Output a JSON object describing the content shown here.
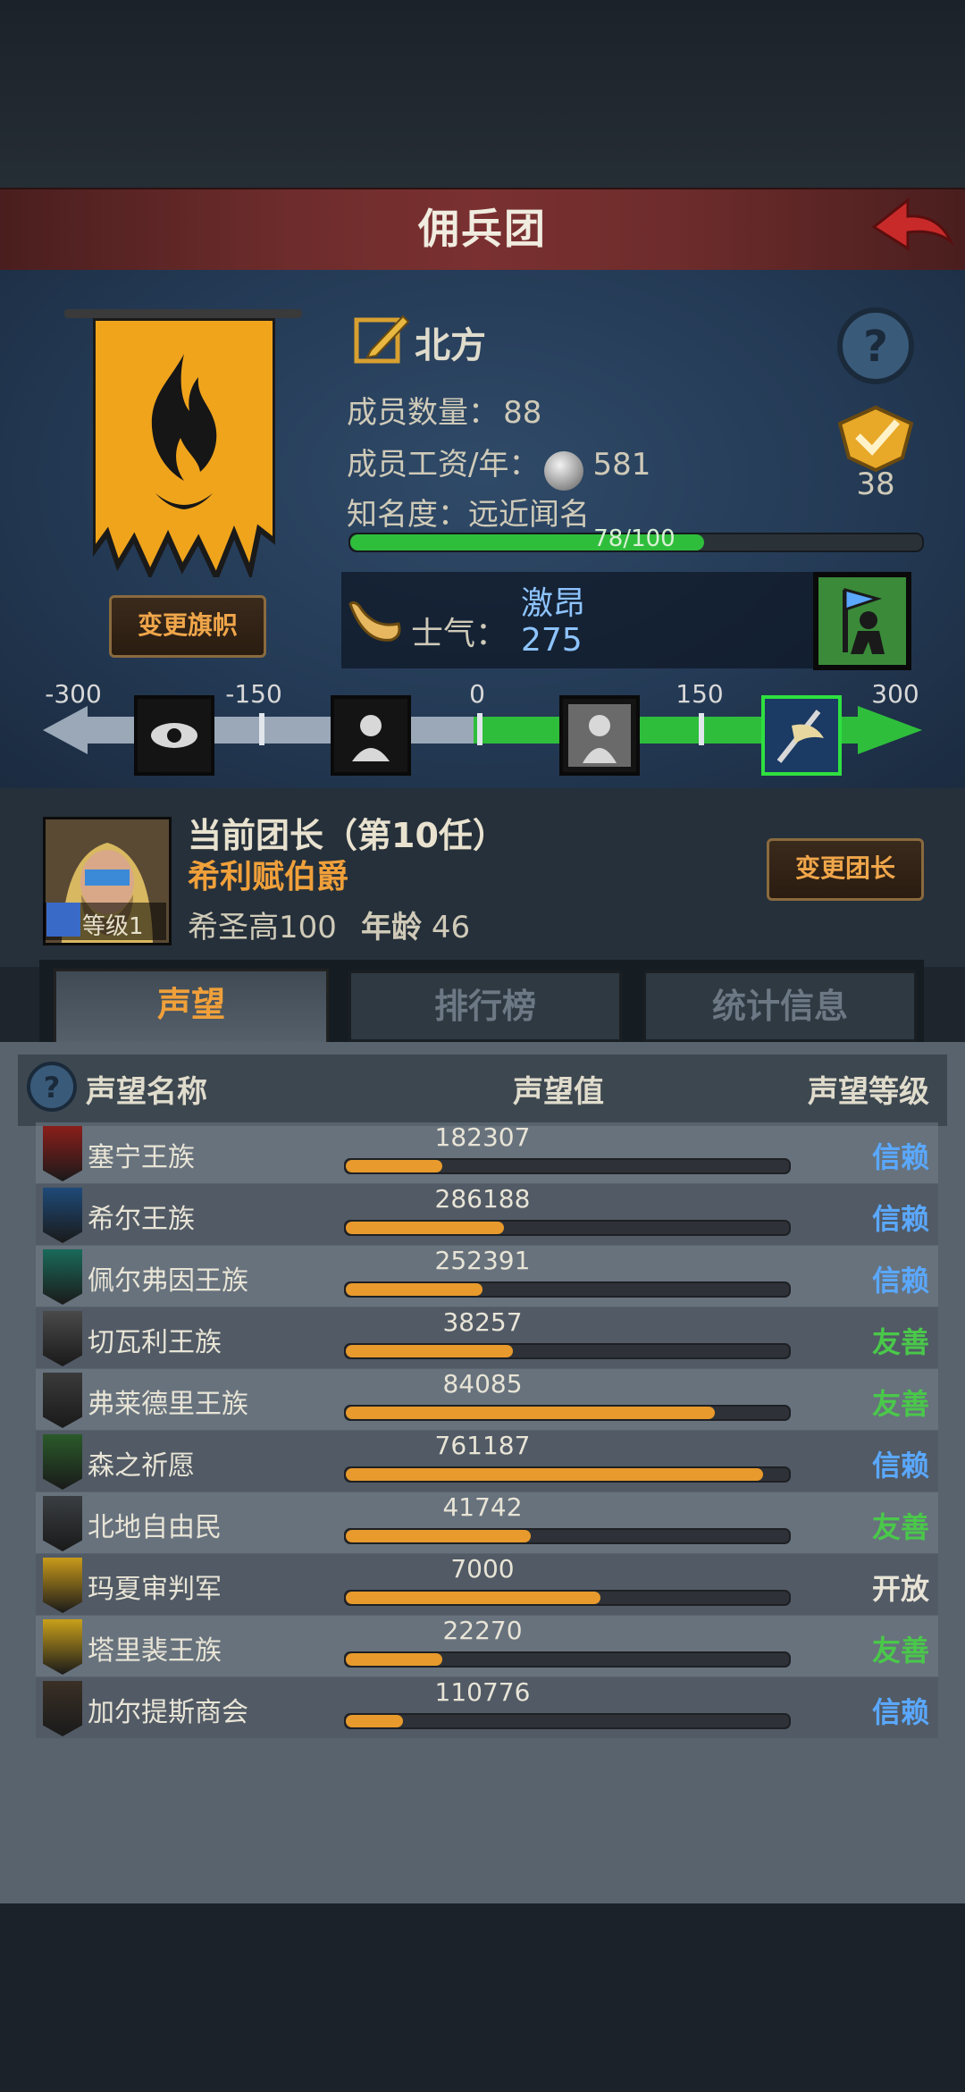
{
  "title": "佣兵团",
  "company": {
    "name": "北方",
    "members_label": "成员数量：",
    "members_value": "88",
    "salary_label": "成员工资/年：",
    "salary_value": "581",
    "fame_label": "知名度：",
    "fame_value": "远近闻名",
    "fame_progress_text": "78/100",
    "fame_progress_fraction": 0.78,
    "quest_count": "38",
    "change_banner_label": "变更旗帜"
  },
  "morale": {
    "label": "士气：",
    "state": "激昂",
    "value": "275",
    "scale_ticks": [
      "-300",
      "-150",
      "0",
      "150",
      "300"
    ],
    "scale_min": -300,
    "scale_max": 300,
    "current": 275
  },
  "leader": {
    "title": "当前团长（第10任）",
    "name": "希利赋伯爵",
    "level": "等级1",
    "skill": "希圣高100",
    "age_label": "年龄",
    "age": "46",
    "change_leader_label": "变更团长"
  },
  "tabs": [
    {
      "label": "声望",
      "active": true
    },
    {
      "label": "排行榜",
      "active": false
    },
    {
      "label": "统计信息",
      "active": false
    }
  ],
  "reputation": {
    "columns": [
      "声望名称",
      "声望值",
      "声望等级"
    ],
    "rows": [
      {
        "name": "塞宁王族",
        "value": "182307",
        "level": "信赖",
        "fill": 0.22,
        "icon_color": "#8a1e1a"
      },
      {
        "name": "希尔王族",
        "value": "286188",
        "level": "信赖",
        "fill": 0.36,
        "icon_color": "#1e4a78"
      },
      {
        "name": "佩尔弗因王族",
        "value": "252391",
        "level": "信赖",
        "fill": 0.31,
        "icon_color": "#1a6a5a"
      },
      {
        "name": "切瓦利王族",
        "value": "38257",
        "level": "友善",
        "fill": 0.38,
        "icon_color": "#4a4a4a"
      },
      {
        "name": "弗莱德里王族",
        "value": "84085",
        "level": "友善",
        "fill": 0.84,
        "icon_color": "#3a3a3a"
      },
      {
        "name": "森之祈愿",
        "value": "761187",
        "level": "信赖",
        "fill": 0.95,
        "icon_color": "#2a5a2a"
      },
      {
        "name": "北地自由民",
        "value": "41742",
        "level": "友善",
        "fill": 0.42,
        "icon_color": "#3a3e42"
      },
      {
        "name": "玛夏审判军",
        "value": "7000",
        "level": "开放",
        "fill": 0.58,
        "icon_color": "#c89a1a"
      },
      {
        "name": "塔里裴王族",
        "value": "22270",
        "level": "友善",
        "fill": 0.22,
        "icon_color": "#c8a01a"
      },
      {
        "name": "加尔提斯商会",
        "value": "110776",
        "level": "信赖",
        "fill": 0.13,
        "icon_color": "#3a3026"
      }
    ]
  },
  "colors": {
    "trust": "#5aa8ff",
    "friendly": "#4ac84a",
    "open": "#e8e4d6",
    "accent_orange": "#f0a03a",
    "progress_green": "#2fbe3c"
  }
}
